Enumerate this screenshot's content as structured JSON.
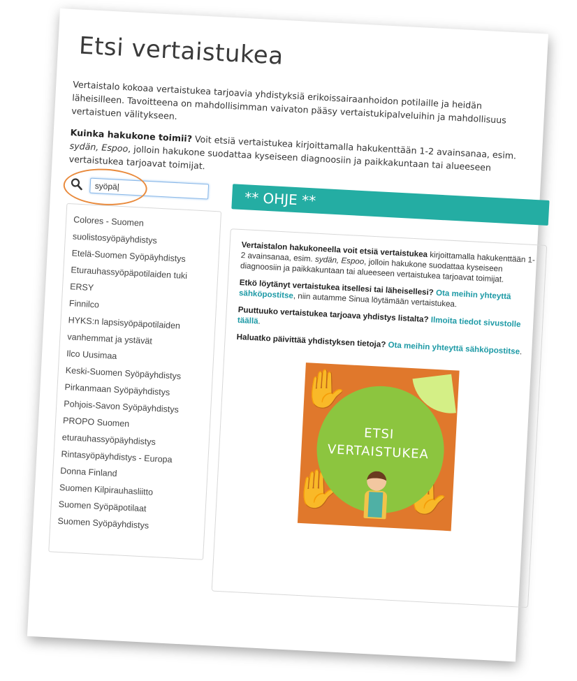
{
  "page": {
    "title": "Etsi vertaistukea",
    "intro": "Vertaistalo kokoaa vertaistukea tarjoavia yhdistyksiä erikoissairaanhoidon potilaille ja heidän läheisilleen. Tavoitteena on mahdollisimman vaivaton pääsy vertaistukipalveluihin ja mahdollisuus vertaistuen välitykseen.",
    "howto_lead": "Kuinka hakukone toimii?",
    "howto_text_1": " Voit etsiä vertaistukea kirjoittamalla hakukenttään 1-2 avainsanaa, esim. ",
    "howto_em_1": "sydän, Espoo",
    "howto_text_2": ", jolloin hakukone suodattaa kyseiseen diagnoosiin ja paikkakuntaan tai alueeseen vertaistukea tarjoavat toimijat."
  },
  "search": {
    "value": "syöpä|",
    "icon": "search-icon"
  },
  "results": [
    "Colores - Suomen",
    "suolistosyöpäyhdistys",
    "Etelä-Suomen Syöpäyhdistys",
    "Eturauhassyöpäpotilaiden tuki",
    "ERSY",
    "Finnilco",
    "HYKS:n lapsisyöpäpotilaiden",
    "vanhemmat ja ystävät",
    "Ilco Uusimaa",
    "Keski-Suomen Syöpäyhdistys",
    "Pirkanmaan Syöpäyhdistys",
    "Pohjois-Savon Syöpäyhdistys",
    "PROPO Suomen",
    "eturauhassyöpäyhdistys",
    "Rintasyöpäyhdistys - Europa",
    "Donna Finland",
    "Suomen Kilpirauhasliitto",
    "Suomen Syöpäpotilaat",
    "Suomen Syöpäyhdistys"
  ],
  "ohje": {
    "banner": "** OHJE **",
    "p1_bold": "Vertaistalon hakukoneella voit etsiä vertaistukea",
    "p1_text_a": " kirjoittamalla hakukenttään 1-2 avainsanaa, esim. ",
    "p1_em": "sydän, Espoo",
    "p1_text_b": ", jolloin hakukone suodattaa kyseiseen diagnoosiin ja paikkakuntaan tai alueeseen vertaistukea tarjoavat toimijat.",
    "p2_bold": "Etkö löytänyt vertaistukea itsellesi tai läheisellesi?",
    "p2_link": " Ota meihin yhteyttä sähköpostitse",
    "p2_text": ", niin autamme Sinua löytämään vertaistukea.",
    "p3_bold": "Puuttuuko vertaistukea tarjoava yhdistys listalta?",
    "p3_link": " Ilmoita tiedot sivustolle täällä",
    "p3_text": ".",
    "p4_bold": "Haluatko päivittää yhdistyksen tietoja?",
    "p4_link": " Ota meihin yhteyttä sähköpostitse",
    "p4_text": "."
  },
  "promo": {
    "line1": "ETSI",
    "line2": "VERTAISTUKEA"
  },
  "colors": {
    "accent_teal": "#24ada3",
    "link_teal": "#1e9aa6",
    "highlight_orange": "#e98a3c",
    "promo_green": "#8cc53f",
    "promo_orange": "#e0782c"
  }
}
